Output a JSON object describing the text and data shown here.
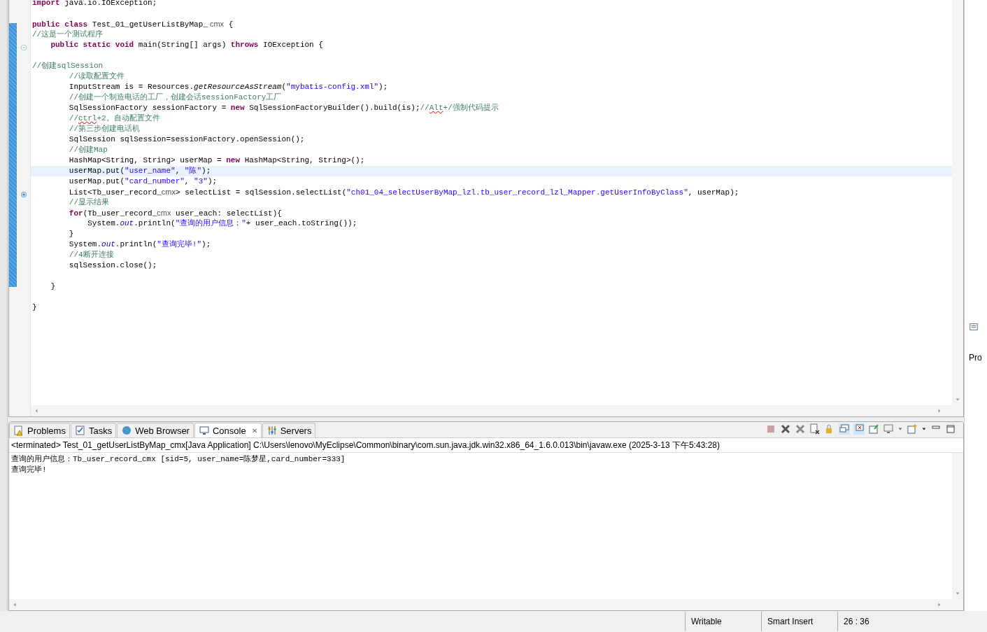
{
  "editor": {
    "lines": [
      {
        "kind": "plain",
        "highlighted": false,
        "tokens": [
          {
            "kind": "kw",
            "text": "import"
          },
          {
            "kind": "plain",
            "text": " java.io.IOException;"
          }
        ]
      },
      {
        "kind": "plain",
        "highlighted": false
      },
      {
        "kind": "plain",
        "highlighted": false,
        "tokens": [
          {
            "kind": "kw",
            "text": "public class"
          },
          {
            "kind": "plain",
            "text": " Test_01_getUserListByMap_"
          },
          {
            "kind": "sans",
            "text": " cmx"
          },
          {
            "kind": "plain",
            "text": " {"
          }
        ]
      },
      {
        "kind": "plain",
        "highlighted": false,
        "tokens": [
          {
            "kind": "comment",
            "text": "//这是一个测试程序"
          }
        ]
      },
      {
        "kind": "fold",
        "highlighted": false,
        "tokens": [
          {
            "kind": "kw",
            "text": "    public static void"
          },
          {
            "kind": "plain",
            "text": " main(String[] args) "
          },
          {
            "kind": "kw",
            "text": "throws"
          },
          {
            "kind": "plain",
            "text": " IOException {"
          }
        ]
      },
      {
        "kind": "plain",
        "highlighted": false
      },
      {
        "kind": "plain",
        "highlighted": false,
        "tokens": [
          {
            "kind": "comment",
            "text": "//创建sqlSession"
          }
        ]
      },
      {
        "kind": "plain",
        "highlighted": false,
        "tokens": [
          {
            "kind": "comment",
            "text": "        //读取配置文件"
          }
        ]
      },
      {
        "kind": "plain",
        "highlighted": false,
        "tokens": [
          {
            "kind": "plain",
            "text": "        InputStream is = Resources."
          },
          {
            "kind": "method",
            "text": "getResourceAsStream"
          },
          {
            "kind": "plain",
            "text": "("
          },
          {
            "kind": "str",
            "text": "\"mybatis-config.xml\""
          },
          {
            "kind": "plain",
            "text": ");"
          }
        ]
      },
      {
        "kind": "plain",
        "highlighted": false,
        "tokens": [
          {
            "kind": "comment",
            "text": "        //创建一个制造电话的工厂，创建会话sessionFactory工厂"
          }
        ]
      },
      {
        "kind": "plain",
        "highlighted": false,
        "tokens": [
          {
            "kind": "plain",
            "text": "        SqlSessionFactory sessionFactory = "
          },
          {
            "kind": "kw",
            "text": "new"
          },
          {
            "kind": "plain",
            "text": " SqlSessionFactoryBuilder().build(is);"
          },
          {
            "kind": "comment",
            "text": "//"
          },
          {
            "kind": "spell",
            "text": "Alt"
          },
          {
            "kind": "comment",
            "text": "+/强制代码提示"
          }
        ]
      },
      {
        "kind": "plain",
        "highlighted": false,
        "tokens": [
          {
            "kind": "comment",
            "text": "        //"
          },
          {
            "kind": "spell",
            "text": "ctrl"
          },
          {
            "kind": "comment",
            "text": "+2。自动配置文件"
          }
        ]
      },
      {
        "kind": "plain",
        "highlighted": false,
        "tokens": [
          {
            "kind": "comment",
            "text": "        //第三步创建电话机"
          }
        ]
      },
      {
        "kind": "plain",
        "highlighted": false,
        "tokens": [
          {
            "kind": "plain",
            "text": "        SqlSession sqlSession=sessionFactory.openSession();"
          }
        ]
      },
      {
        "kind": "plain",
        "highlighted": false,
        "tokens": [
          {
            "kind": "comment",
            "text": "        //创建Map"
          }
        ]
      },
      {
        "kind": "plain",
        "highlighted": false,
        "tokens": [
          {
            "kind": "plain",
            "text": "        HashMap<String, String> userMap = "
          },
          {
            "kind": "kw",
            "text": "new"
          },
          {
            "kind": "plain",
            "text": " HashMap<String, String>();"
          }
        ]
      },
      {
        "kind": "plain",
        "highlighted": true,
        "tokens": [
          {
            "kind": "plain",
            "text": "        userMap.put("
          },
          {
            "kind": "str",
            "text": "\"user_name\""
          },
          {
            "kind": "plain",
            "text": ", "
          },
          {
            "kind": "str",
            "text": "\"陈\""
          },
          {
            "kind": "plain",
            "text": ");"
          }
        ]
      },
      {
        "kind": "plain",
        "highlighted": false,
        "tokens": [
          {
            "kind": "plain",
            "text": "        userMap.put("
          },
          {
            "kind": "str",
            "text": "\"card_number\""
          },
          {
            "kind": "plain",
            "text": ", "
          },
          {
            "kind": "str",
            "text": "\"3\""
          },
          {
            "kind": "plain",
            "text": ");"
          }
        ]
      },
      {
        "kind": "marker",
        "highlighted": false,
        "tokens": [
          {
            "kind": "plain",
            "text": "        List<Tb_user_record_"
          },
          {
            "kind": "sans",
            "text": "cmx"
          },
          {
            "kind": "plain",
            "text": "> selectList = sqlSession.selectList("
          },
          {
            "kind": "str",
            "text": "\"ch01_04_selectUserByMap_lzl.tb_user_record_lzl_Mapper.getUserInfoByClass\""
          },
          {
            "kind": "plain",
            "text": ", userMap);"
          }
        ]
      },
      {
        "kind": "plain",
        "highlighted": false,
        "tokens": [
          {
            "kind": "comment",
            "text": "        //显示结果"
          }
        ]
      },
      {
        "kind": "plain",
        "highlighted": false,
        "tokens": [
          {
            "kind": "kw",
            "text": "        for"
          },
          {
            "kind": "plain",
            "text": "(Tb_user_record_"
          },
          {
            "kind": "sans",
            "text": "cmx"
          },
          {
            "kind": "plain",
            "text": " user_each: selectList){"
          }
        ]
      },
      {
        "kind": "plain",
        "highlighted": false,
        "tokens": [
          {
            "kind": "plain",
            "text": "            System."
          },
          {
            "kind": "field",
            "text": "out"
          },
          {
            "kind": "plain",
            "text": ".println("
          },
          {
            "kind": "str",
            "text": "\"查询的用户信息：\""
          },
          {
            "kind": "plain",
            "text": "+ user_each.toString());"
          }
        ]
      },
      {
        "kind": "plain",
        "highlighted": false,
        "tokens": [
          {
            "kind": "plain",
            "text": "        }"
          }
        ]
      },
      {
        "kind": "plain",
        "highlighted": false,
        "tokens": [
          {
            "kind": "plain",
            "text": "        System."
          },
          {
            "kind": "field",
            "text": "out"
          },
          {
            "kind": "plain",
            "text": ".println("
          },
          {
            "kind": "str",
            "text": "\"查询完毕!\""
          },
          {
            "kind": "plain",
            "text": ");"
          }
        ]
      },
      {
        "kind": "plain",
        "highlighted": false,
        "tokens": [
          {
            "kind": "comment",
            "text": "        //4断开连接"
          }
        ]
      },
      {
        "kind": "plain",
        "highlighted": false,
        "tokens": [
          {
            "kind": "plain",
            "text": "        sqlSession.close();"
          }
        ]
      },
      {
        "kind": "plain",
        "highlighted": false
      },
      {
        "kind": "plain",
        "highlighted": false,
        "tokens": [
          {
            "kind": "plain",
            "text": "    }"
          }
        ]
      },
      {
        "kind": "plain",
        "highlighted": false
      },
      {
        "kind": "plain",
        "highlighted": false,
        "tokens": [
          {
            "kind": "plain",
            "text": "}"
          }
        ]
      }
    ]
  },
  "bottom_panel": {
    "tabs": [
      {
        "label": "Problems",
        "selected": false,
        "closable": false
      },
      {
        "label": "Tasks",
        "selected": false,
        "closable": false
      },
      {
        "label": "Web Browser",
        "selected": false,
        "closable": false
      },
      {
        "label": "Console",
        "selected": true,
        "closable": true
      },
      {
        "label": "Servers",
        "selected": false,
        "closable": false
      }
    ],
    "close_glyph": "✕",
    "console_header": "<terminated> Test_01_getUserListByMap_cmx[Java Application] C:\\Users\\lenovo\\MyEclipse\\Common\\binary\\com.sun.java.jdk.win32.x86_64_1.6.0.013\\bin\\javaw.exe (2025-3-13 下午5:43:28)",
    "output": [
      "查询的用户信息：Tb_user_record_cmx [sid=5, user_name=陈梦星,card_number=333]",
      "查询完毕!"
    ]
  },
  "right_panel": {
    "label": "Pro"
  },
  "status_bar": [
    "Writable",
    "Smart Insert",
    "26 : 36"
  ]
}
